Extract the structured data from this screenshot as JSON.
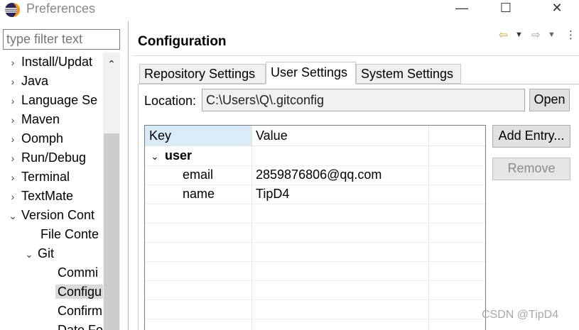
{
  "window": {
    "title": "Preferences",
    "minimize_glyph": "—",
    "maximize_glyph": "☐",
    "close_glyph": "✕"
  },
  "sidebar": {
    "filter_placeholder": "type filter text",
    "scroll_up_glyph": "⌃",
    "items": [
      {
        "label": "Install/Updat",
        "arrow": "›",
        "level": 0
      },
      {
        "label": "Java",
        "arrow": "›",
        "level": 0
      },
      {
        "label": "Language Se",
        "arrow": "›",
        "level": 0
      },
      {
        "label": "Maven",
        "arrow": "›",
        "level": 0
      },
      {
        "label": "Oomph",
        "arrow": "›",
        "level": 0
      },
      {
        "label": "Run/Debug",
        "arrow": "›",
        "level": 0
      },
      {
        "label": "Terminal",
        "arrow": "›",
        "level": 0
      },
      {
        "label": "TextMate",
        "arrow": "›",
        "level": 0
      },
      {
        "label": "Version Cont",
        "arrow": "⌄",
        "level": 0
      },
      {
        "label": "File Conte",
        "arrow": "",
        "level": 1
      },
      {
        "label": "Git",
        "arrow": "⌄",
        "level": 1
      },
      {
        "label": "Commi",
        "arrow": "",
        "level": 2
      },
      {
        "label": "Configu",
        "arrow": "",
        "level": 2
      },
      {
        "label": "Confirm",
        "arrow": "",
        "level": 2
      },
      {
        "label": "Date Fo",
        "arrow": "",
        "level": 2
      }
    ]
  },
  "page": {
    "title": "Configuration",
    "nav": {
      "back_glyph": "⇦",
      "back_menu_glyph": "▼",
      "forward_glyph": "⇨",
      "forward_menu_glyph": "▼",
      "more_glyph": "⋮"
    },
    "tabs": [
      {
        "label": "Repository Settings"
      },
      {
        "label": "User Settings"
      },
      {
        "label": "System Settings"
      }
    ],
    "location_label": "Location:",
    "location_value": "C:\\Users\\Q\\.gitconfig",
    "open_label": "Open",
    "add_entry_label": "Add Entry...",
    "remove_label": "Remove",
    "table": {
      "col_key": "Key",
      "col_value": "Value",
      "section": {
        "name": "user",
        "chevron": "⌄"
      },
      "rows": [
        {
          "key": "email",
          "value": "2859876806@qq.com"
        },
        {
          "key": "name",
          "value": "TipD4"
        }
      ]
    }
  },
  "watermark": "CSDN @TipD4",
  "colors": {
    "selection": "#d9d9d9",
    "header_highlight": "#d9ebf9",
    "accent": "#2b5797"
  }
}
